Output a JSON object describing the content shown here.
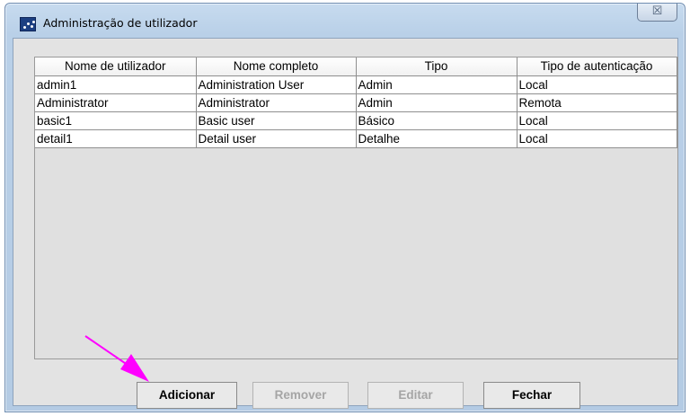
{
  "window": {
    "title": "Administração de utilizador",
    "close_symbol": "☒"
  },
  "table": {
    "columns": [
      "Nome de utilizador",
      "Nome completo",
      "Tipo",
      "Tipo de autenticação"
    ],
    "rows": [
      [
        "admin1",
        "Administration User",
        "Admin",
        "Local"
      ],
      [
        "Administrator",
        "Administrator",
        "Admin",
        "Remota"
      ],
      [
        "basic1",
        "Basic user",
        "Básico",
        "Local"
      ],
      [
        "detail1",
        "Detail user",
        "Detalhe",
        "Local"
      ]
    ]
  },
  "buttons": {
    "add": "Adicionar",
    "remove": "Remover",
    "edit": "Editar",
    "close": "Fechar"
  },
  "colors": {
    "annotation_arrow": "#ff00ff"
  }
}
